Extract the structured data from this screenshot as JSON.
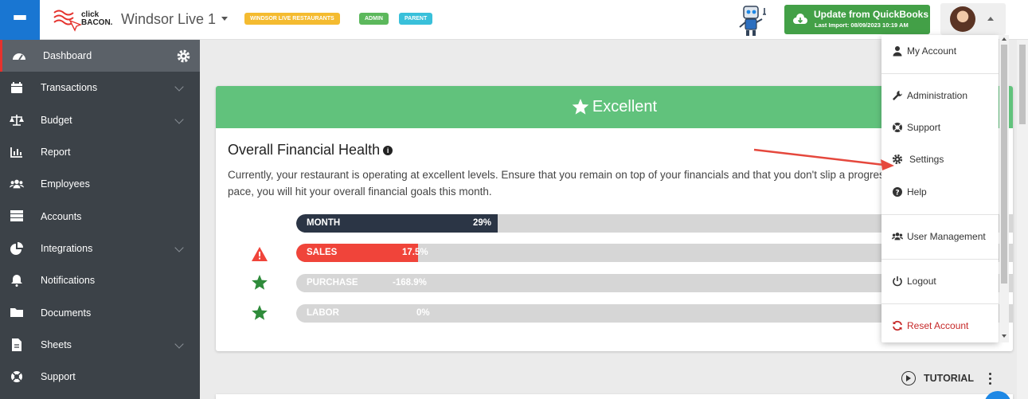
{
  "header": {
    "brand_line1": "click",
    "brand_line2": "BACON.",
    "company": "Windsor Live 1",
    "badges": [
      "WINDSOR LIVE RESTAURANTS",
      "ADMIN",
      "PARENT"
    ],
    "quickbooks_title": "Update from QuickBooks",
    "quickbooks_sub": "Last Import: 08/09/2023 10:19 AM"
  },
  "sidebar": {
    "items": [
      {
        "label": "Dashboard",
        "icon": "dashboard-icon"
      },
      {
        "label": "Transactions",
        "icon": "calendar-icon"
      },
      {
        "label": "Budget",
        "icon": "scale-icon"
      },
      {
        "label": "Report",
        "icon": "bar-chart-icon"
      },
      {
        "label": "Employees",
        "icon": "users-icon"
      },
      {
        "label": "Accounts",
        "icon": "list-icon"
      },
      {
        "label": "Integrations",
        "icon": "pie-chart-icon"
      },
      {
        "label": "Notifications",
        "icon": "bell-icon"
      },
      {
        "label": "Documents",
        "icon": "folder-icon"
      },
      {
        "label": "Sheets",
        "icon": "file-icon"
      },
      {
        "label": "Support",
        "icon": "life-ring-icon"
      }
    ]
  },
  "health": {
    "status": "Excellent",
    "title": "Overall Financial Health",
    "info": "i",
    "description": "Currently, your restaurant is operating at excellent levels. Ensure that you remain on top of your financials and that you don't slip a progresses. At this pace, you will hit your overall financial goals this month.",
    "bars": [
      {
        "label": "MONTH",
        "value": "29%",
        "fill_fraction": 0.29,
        "color": "#2b3545",
        "indicator": "none"
      },
      {
        "label": "SALES",
        "value": "17.5%",
        "fill_fraction": 0.175,
        "color": "#f0443a",
        "indicator": "warning"
      },
      {
        "label": "PURCHASE",
        "value": "-168.9%",
        "fill_fraction": 0,
        "color": "#d6d6d6",
        "indicator": "star"
      },
      {
        "label": "LABOR",
        "value": "0%",
        "fill_fraction": 0,
        "color": "#d6d6d6",
        "indicator": "star"
      }
    ]
  },
  "tutorial": {
    "label": "TUTORIAL"
  },
  "user_menu": {
    "items": [
      {
        "label": "My Account",
        "icon": "user-icon"
      },
      {
        "label": "Administration",
        "icon": "wrench-icon"
      },
      {
        "label": "Support",
        "icon": "life-ring-icon"
      },
      {
        "label": "Settings",
        "icon": "gear-icon"
      },
      {
        "label": "Help",
        "icon": "question-icon"
      },
      {
        "label": "User Management",
        "icon": "users-icon"
      },
      {
        "label": "Logout",
        "icon": "power-icon"
      },
      {
        "label": "Reset Account",
        "icon": "refresh-icon"
      }
    ]
  },
  "colors": {
    "brand_blue": "#1976d2",
    "excellent_green": "#61c27c",
    "quickbooks_green": "#43a047",
    "sidebar_bg": "#3c4248",
    "alert_red": "#f0443a",
    "star_green": "#2e8b3a"
  }
}
